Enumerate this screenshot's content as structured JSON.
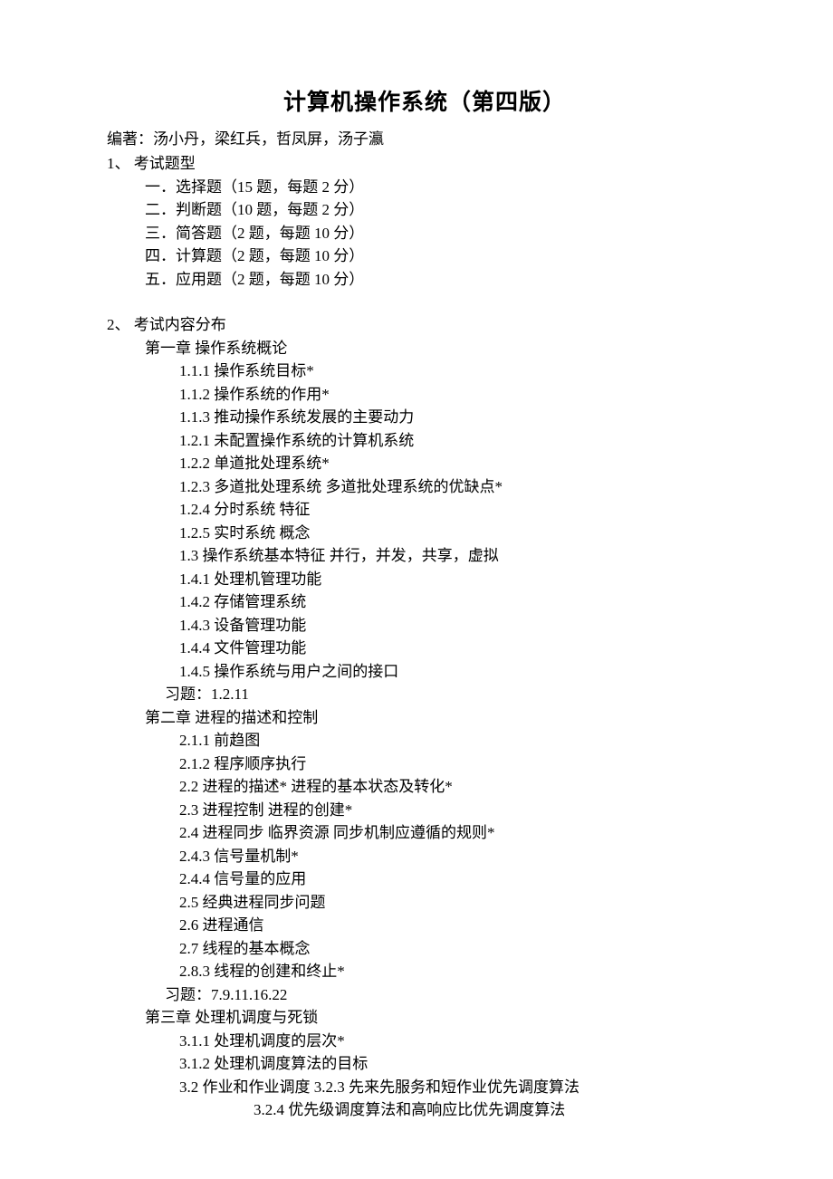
{
  "title": "计算机操作系统（第四版）",
  "authors": "编著：汤小丹，梁红兵，哲凤屏，汤子瀛",
  "section1": {
    "heading": "1、 考试题型",
    "items": [
      "一．选择题（15 题，每题 2 分）",
      "二．判断题（10 题，每题 2 分）",
      "三．简答题（2 题，每题 10 分）",
      "四．计算题（2 题，每题 10 分）",
      "五．应用题（2 题，每题 10 分）"
    ]
  },
  "section2": {
    "heading": "2、 考试内容分布",
    "chapters": [
      {
        "title": "第一章  操作系统概论",
        "items": [
          "1.1.1 操作系统目标*",
          "1.1.2 操作系统的作用*",
          "1.1.3 推动操作系统发展的主要动力",
          "1.2.1 未配置操作系统的计算机系统",
          "1.2.2 单道批处理系统*",
          "1.2.3 多道批处理系统  多道批处理系统的优缺点*",
          "1.2.4 分时系统  特征",
          "1.2.5 实时系统  概念",
          "1.3 操作系统基本特征  并行，并发，共享，虚拟",
          "1.4.1 处理机管理功能",
          "1.4.2 存储管理系统",
          "1.4.3 设备管理功能",
          "1.4.4 文件管理功能",
          "1.4.5 操作系统与用户之间的接口"
        ],
        "exercises": "习题：1.2.11"
      },
      {
        "title": "第二章  进程的描述和控制",
        "items": [
          "2.1.1 前趋图",
          "2.1.2 程序顺序执行",
          "2.2 进程的描述*   进程的基本状态及转化*",
          "2.3 进程控制    进程的创建*",
          "2.4 进程同步  临界资源    同步机制应遵循的规则*",
          "2.4.3 信号量机制*",
          "2.4.4 信号量的应用",
          "2.5 经典进程同步问题",
          "2.6 进程通信",
          "2.7 线程的基本概念",
          "2.8.3 线程的创建和终止*"
        ],
        "exercises": "习题：7.9.11.16.22"
      },
      {
        "title": "第三章  处理机调度与死锁",
        "items": [
          "3.1.1 处理机调度的层次*",
          "3.1.2 处理机调度算法的目标",
          "3.2 作业和作业调度    3.2.3 先来先服务和短作业优先调度算法"
        ],
        "extra_indented": "3.2.4 优先级调度算法和高响应比优先调度算法"
      }
    ]
  }
}
